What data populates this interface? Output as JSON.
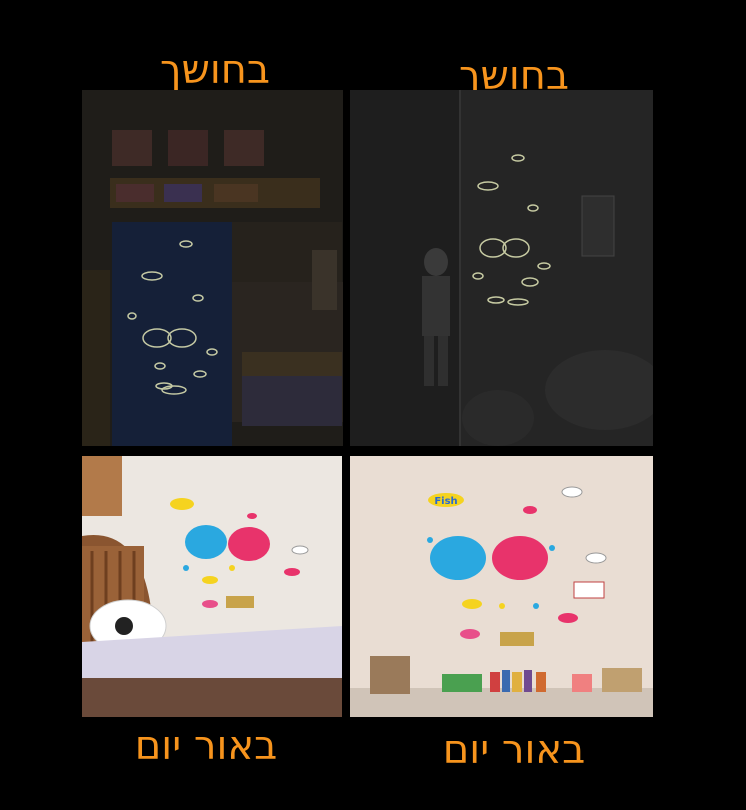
{
  "captions": {
    "dark_left": "בחושך",
    "dark_right": "בחושך",
    "day_left": "באור יום",
    "day_right": "באור יום"
  },
  "sticker_label": "Fish",
  "colors": {
    "caption": "#F7941D",
    "background": "#000000",
    "glow": "#d8dcb0",
    "whale_blue": "#2aa8e0",
    "whale_pink": "#e8336b"
  }
}
